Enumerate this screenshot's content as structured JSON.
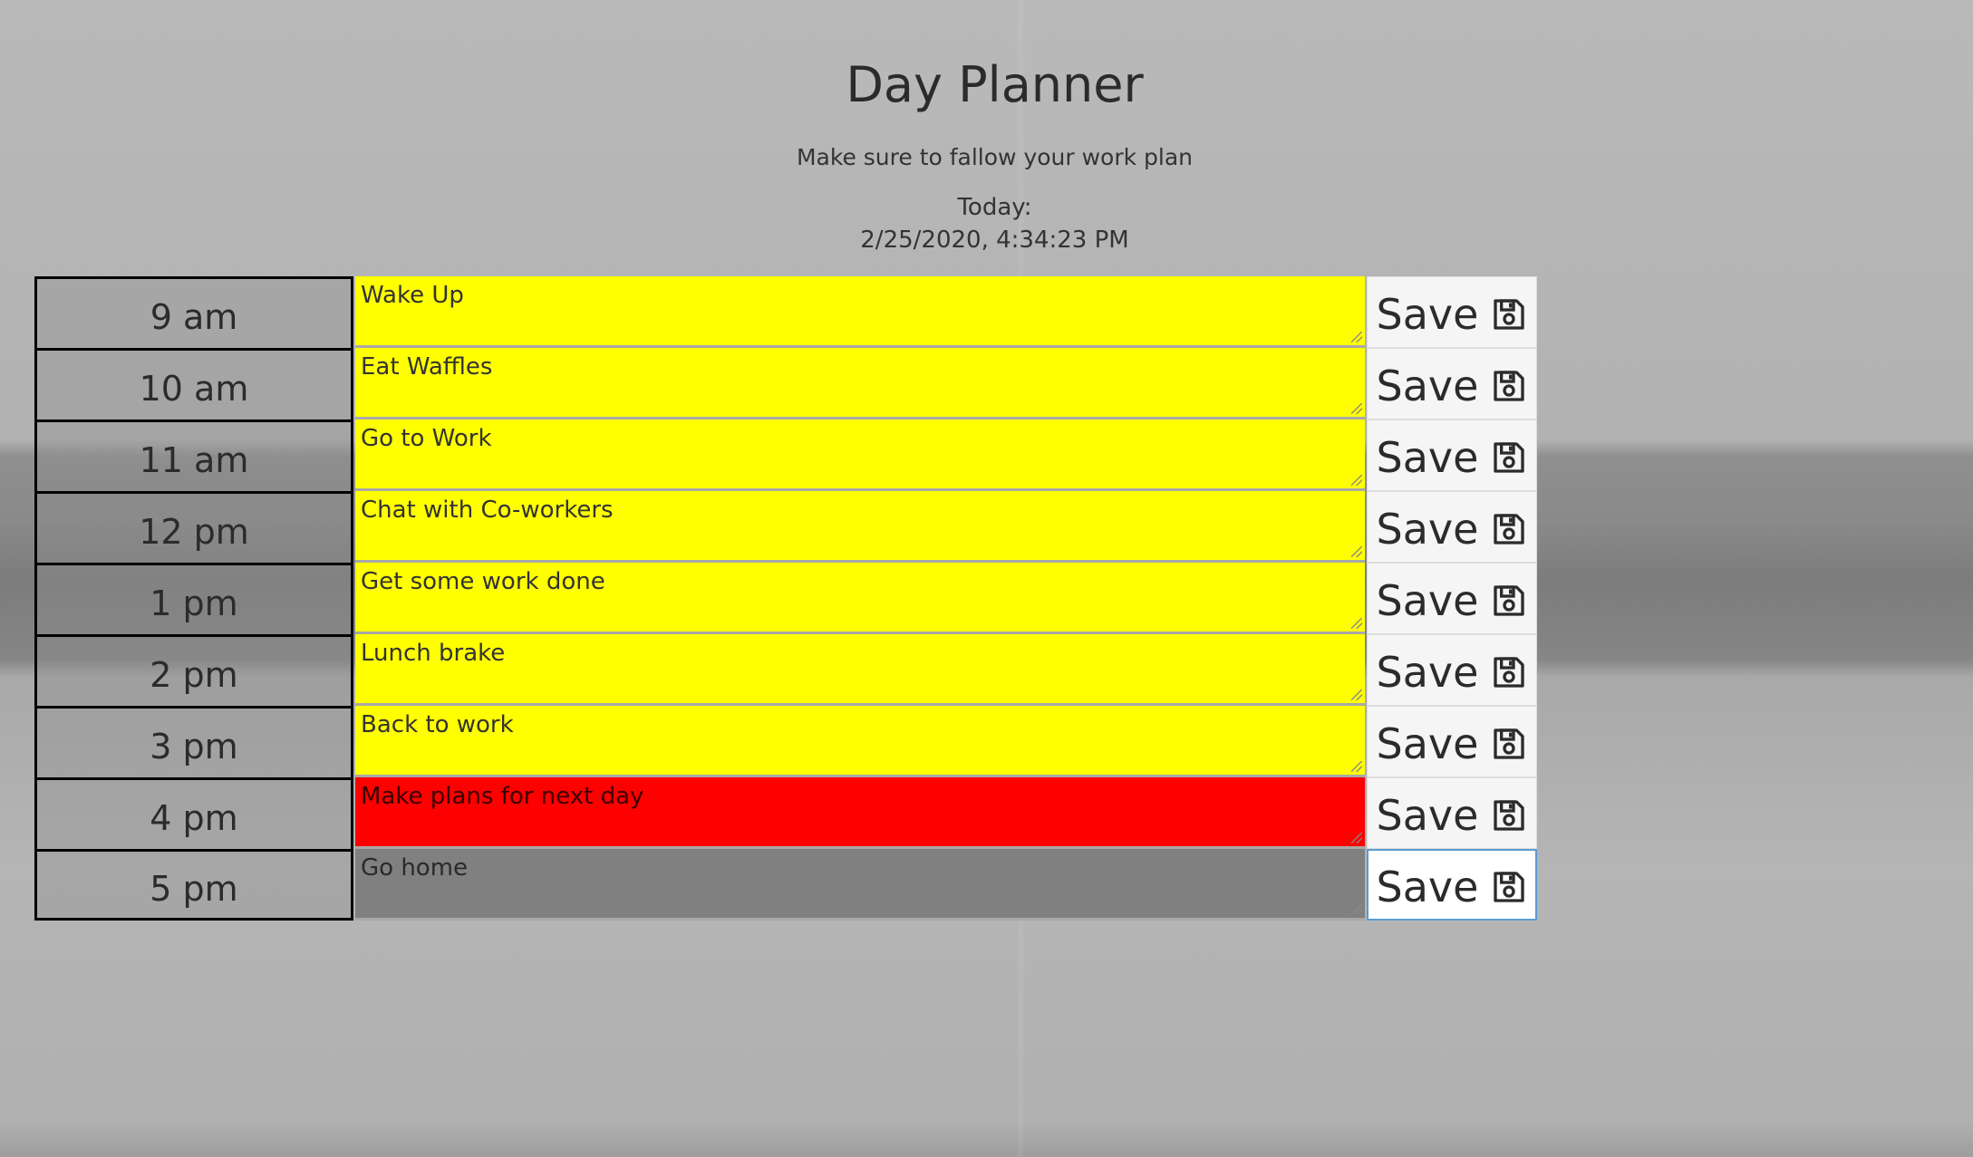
{
  "header": {
    "title": "Day Planner",
    "subtitle": "Make sure to fallow your work plan",
    "today_label": "Today:",
    "today_value": "2/25/2020, 4:34:23 PM"
  },
  "save_label": "Save",
  "save_icon": "floppy-disk-icon",
  "colors": {
    "future": "#ffff00",
    "present": "#ff0000",
    "past": "#808080"
  },
  "rows": [
    {
      "hour": "9 am",
      "task": "Wake Up",
      "state": "future"
    },
    {
      "hour": "10 am",
      "task": "Eat Waffles",
      "state": "future"
    },
    {
      "hour": "11 am",
      "task": "Go to Work",
      "state": "future"
    },
    {
      "hour": "12 pm",
      "task": "Chat with Co-workers",
      "state": "future"
    },
    {
      "hour": "1 pm",
      "task": "Get some work done",
      "state": "future"
    },
    {
      "hour": "2 pm",
      "task": "Lunch brake",
      "state": "future"
    },
    {
      "hour": "3 pm",
      "task": "Back to work",
      "state": "future"
    },
    {
      "hour": "4 pm",
      "task": "Make plans for next day",
      "state": "present"
    },
    {
      "hour": "5 pm",
      "task": "Go home",
      "state": "past"
    }
  ]
}
